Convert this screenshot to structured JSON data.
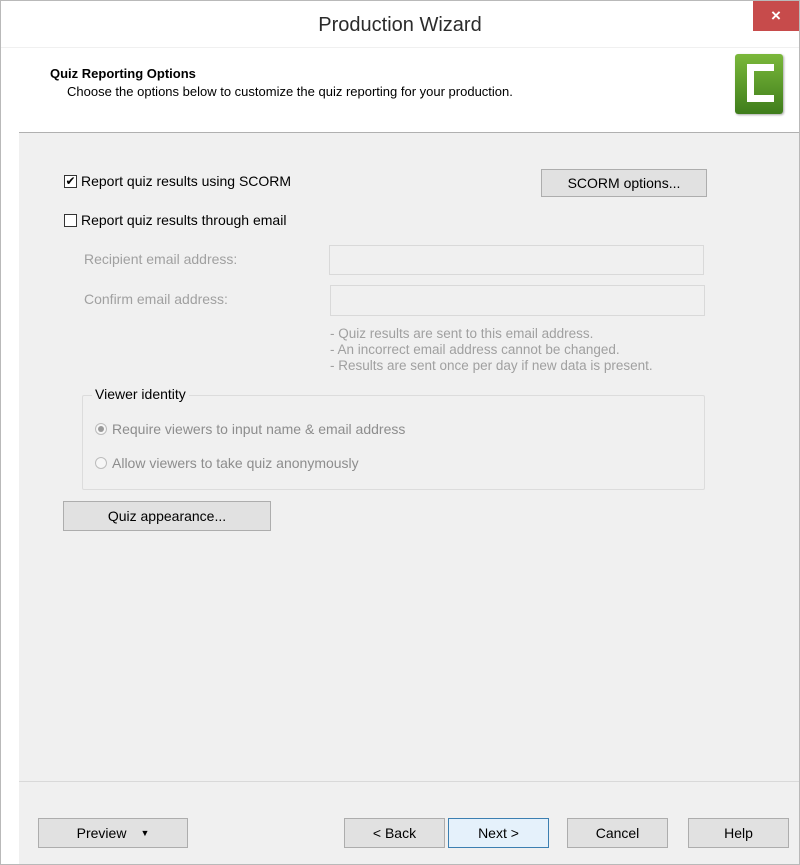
{
  "window": {
    "title": "Production Wizard",
    "close_glyph": "×"
  },
  "header": {
    "title": "Quiz Reporting Options",
    "subtitle": "Choose the options below to customize the quiz reporting for your production.",
    "logo_icon": "camtasia-logo-icon"
  },
  "options": {
    "scorm_label": "Report quiz results using SCORM",
    "scorm_checked": true,
    "scorm_options_button": "SCORM options...",
    "email_label": "Report quiz results through email",
    "email_checked": false,
    "recipient_label": "Recipient email address:",
    "recipient_value": "",
    "confirm_label": "Confirm email address:",
    "confirm_value": "",
    "notes": [
      "- Quiz results are sent to this email address.",
      "- An incorrect email address cannot be changed.",
      "- Results are sent once per day if new data is present."
    ]
  },
  "viewer_identity": {
    "group_label": "Viewer identity",
    "require_label": "Require viewers to input name & email address",
    "anonymous_label": "Allow viewers to take quiz anonymously",
    "selected": "require"
  },
  "quiz_appearance_button": "Quiz appearance...",
  "footer": {
    "preview": "Preview",
    "back": "< Back",
    "next": "Next >",
    "cancel": "Cancel",
    "help": "Help"
  },
  "colors": {
    "close": "#c74b4b",
    "logo_green": "#5a9a2a",
    "primary_border": "#3c7fb1"
  }
}
